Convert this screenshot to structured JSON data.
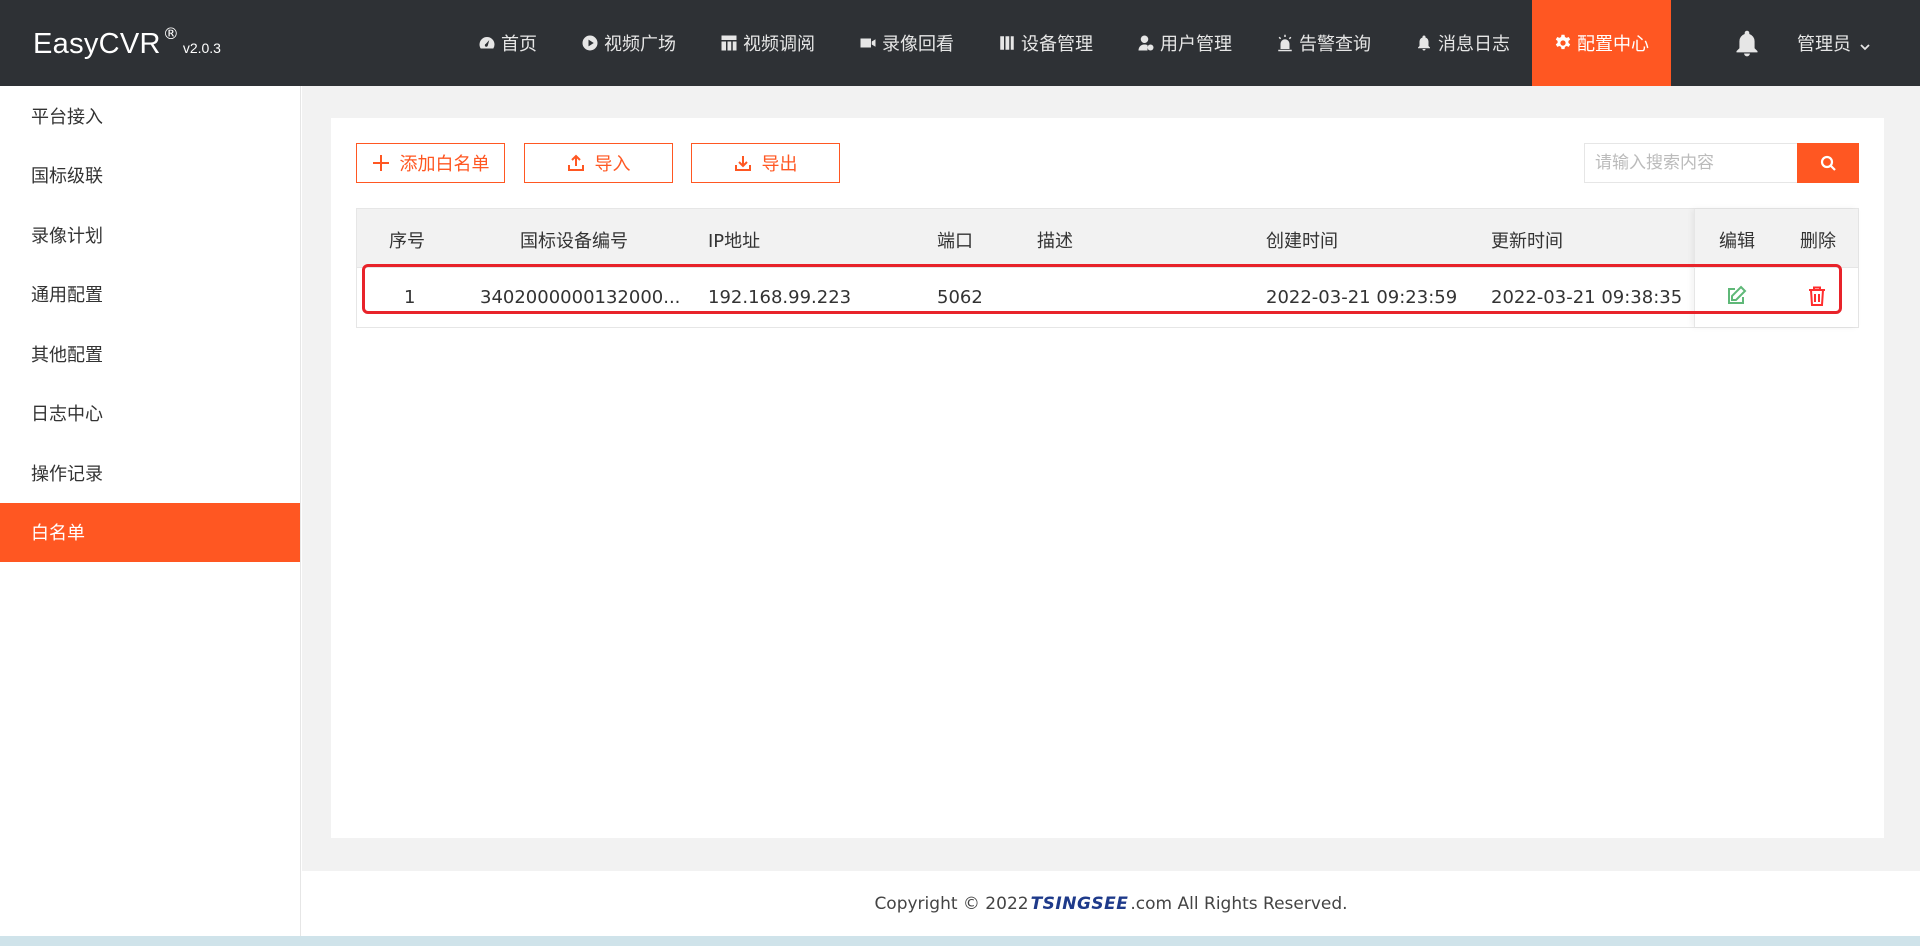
{
  "app": {
    "name": "EasyCVR",
    "reg": "®",
    "version": "v2.0.3"
  },
  "nav": [
    {
      "label": "首页",
      "icon": "dashboard-icon"
    },
    {
      "label": "视频广场",
      "icon": "play-icon"
    },
    {
      "label": "视频调阅",
      "icon": "layout-icon"
    },
    {
      "label": "录像回看",
      "icon": "video-icon"
    },
    {
      "label": "设备管理",
      "icon": "server-icon"
    },
    {
      "label": "用户管理",
      "icon": "user-icon"
    },
    {
      "label": "告警查询",
      "icon": "alarm-icon"
    },
    {
      "label": "消息日志",
      "icon": "bell-icon"
    },
    {
      "label": "配置中心",
      "icon": "gear-icon",
      "active": true
    }
  ],
  "user": {
    "label": "管理员"
  },
  "sidebar": {
    "items": [
      {
        "label": "平台接入"
      },
      {
        "label": "国标级联"
      },
      {
        "label": "录像计划"
      },
      {
        "label": "通用配置"
      },
      {
        "label": "其他配置"
      },
      {
        "label": "日志中心"
      },
      {
        "label": "操作记录"
      },
      {
        "label": "白名单",
        "active": true
      }
    ]
  },
  "toolbar": {
    "add_label": "添加白名单",
    "import_label": "导入",
    "export_label": "导出",
    "search_placeholder": "请输入搜索内容"
  },
  "table": {
    "columns": [
      "序号",
      "国标设备编号",
      "IP地址",
      "端口",
      "描述",
      "创建时间",
      "更新时间",
      "编辑",
      "删除"
    ],
    "rows": [
      {
        "index": "1",
        "device_id": "3402000000132000...",
        "ip": "192.168.99.223",
        "port": "5062",
        "desc": "",
        "created": "2022-03-21 09:23:59",
        "updated": "2022-03-21 09:38:35"
      }
    ]
  },
  "footer": {
    "prefix": "Copyright © 2022 ",
    "brand": "TSINGSEE",
    "suffix": ".com All Rights Reserved."
  },
  "colors": {
    "accent": "#ff5722",
    "header": "#2e3135",
    "highlight": "#e8232a",
    "edit": "#5fb878",
    "delete": "#ff2d2d"
  }
}
